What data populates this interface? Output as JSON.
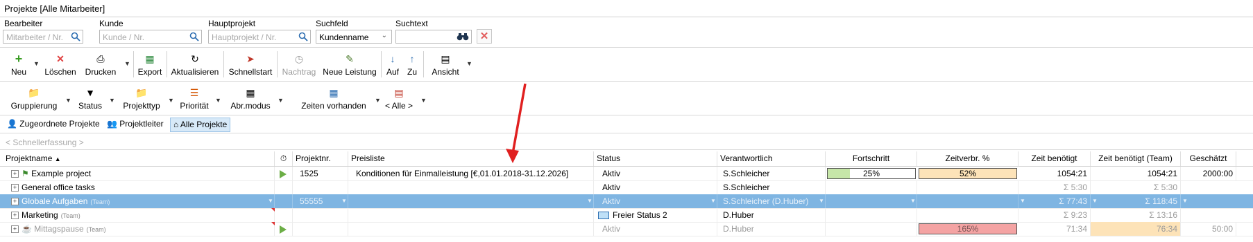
{
  "window": {
    "title": "Projekte",
    "subtitle": "[Alle Mitarbeiter]"
  },
  "filters": {
    "bearbeiter": {
      "label": "Bearbeiter",
      "placeholder": "Mitarbeiter / Nr."
    },
    "kunde": {
      "label": "Kunde",
      "placeholder": "Kunde / Nr."
    },
    "hauptprojekt": {
      "label": "Hauptprojekt",
      "placeholder": "Hauptprojekt / Nr."
    },
    "suchfeld": {
      "label": "Suchfeld",
      "value": "Kundenname"
    },
    "suchtext": {
      "label": "Suchtext",
      "value": ""
    }
  },
  "toolbar1": {
    "neu": "Neu",
    "loeschen": "Löschen",
    "drucken": "Drucken",
    "export": "Export",
    "aktualisieren": "Aktualisieren",
    "schnellstart": "Schnellstart",
    "nachtrag": "Nachtrag",
    "neue_leistung": "Neue Leistung",
    "auf": "Auf",
    "zu": "Zu",
    "ansicht": "Ansicht"
  },
  "toolbar2": {
    "gruppierung": "Gruppierung",
    "status": "Status",
    "projekttyp": "Projekttyp",
    "prioritaet": "Priorität",
    "abrmodus": "Abr.modus",
    "zeiten": "Zeiten vorhanden",
    "alle": "< Alle >"
  },
  "view_tabs": [
    "Zugeordnete Projekte",
    "Projektleiter",
    "Alle Projekte"
  ],
  "quick_entry_placeholder": "< Schnellerfassung >",
  "columns": {
    "projektname": "Projektname",
    "projektnr": "Projektnr.",
    "preisliste": "Preisliste",
    "status": "Status",
    "verantwortlich": "Verantwortlich",
    "fortschritt": "Fortschritt",
    "zeitverbr": "Zeitverbr. %",
    "zeit_benoetigt": "Zeit benötigt",
    "zeit_benoetigt_team": "Zeit benötigt (Team)",
    "geschaetzt": "Geschätzt"
  },
  "rows": [
    {
      "name": "Example project",
      "team": "",
      "nr": "1525",
      "preisliste": "Konditionen für Einmalleistung [€,01.01.2018-31.12.2026]",
      "status": "Aktiv",
      "verantwortlich": "S.Schleicher",
      "fortschritt": "25%",
      "fortschritt_value": 0.25,
      "zeitverbr": "52%",
      "zeitverbr_value": 1.0,
      "zeit": "1054:21",
      "zeit_team": "1054:21",
      "geschaetzt": "2000:00"
    },
    {
      "name": "General office tasks",
      "team": "",
      "nr": "",
      "preisliste": "",
      "status": "Aktiv",
      "verantwortlich": "S.Schleicher",
      "fortschritt": "",
      "zeitverbr": "",
      "zeit": "Σ 5:30",
      "zeit_team": "Σ 5:30",
      "geschaetzt": ""
    },
    {
      "name": "Globale Aufgaben",
      "team": "(Team)",
      "nr": "55555",
      "preisliste": "",
      "status": "Aktiv",
      "verantwortlich": "S.Schleicher (D.Huber)",
      "fortschritt": "",
      "zeitverbr": "",
      "zeit": "Σ 77:43",
      "zeit_team": "Σ 118:45",
      "geschaetzt": ""
    },
    {
      "name": "Marketing",
      "team": "(Team)",
      "nr": "",
      "preisliste": "",
      "status": "Freier Status 2",
      "verantwortlich": "D.Huber",
      "fortschritt": "",
      "zeitverbr": "",
      "zeit": "Σ 9:23",
      "zeit_team": "Σ 13:16",
      "geschaetzt": ""
    },
    {
      "name": "Mittagspause",
      "team": "(Team)",
      "nr": "",
      "preisliste": "",
      "status": "Aktiv",
      "verantwortlich": "D.Huber",
      "fortschritt": "",
      "zeitverbr": "165%",
      "zeit": "71:34",
      "zeit_team": "76:34",
      "geschaetzt": "50:00"
    }
  ],
  "colors": {
    "selected_row": "#7fb5e2",
    "progress_green": "#c6e6a8",
    "time_orange": "#fde3b8",
    "over_red": "#f4a3a3",
    "arrow_red": "#e02020"
  }
}
